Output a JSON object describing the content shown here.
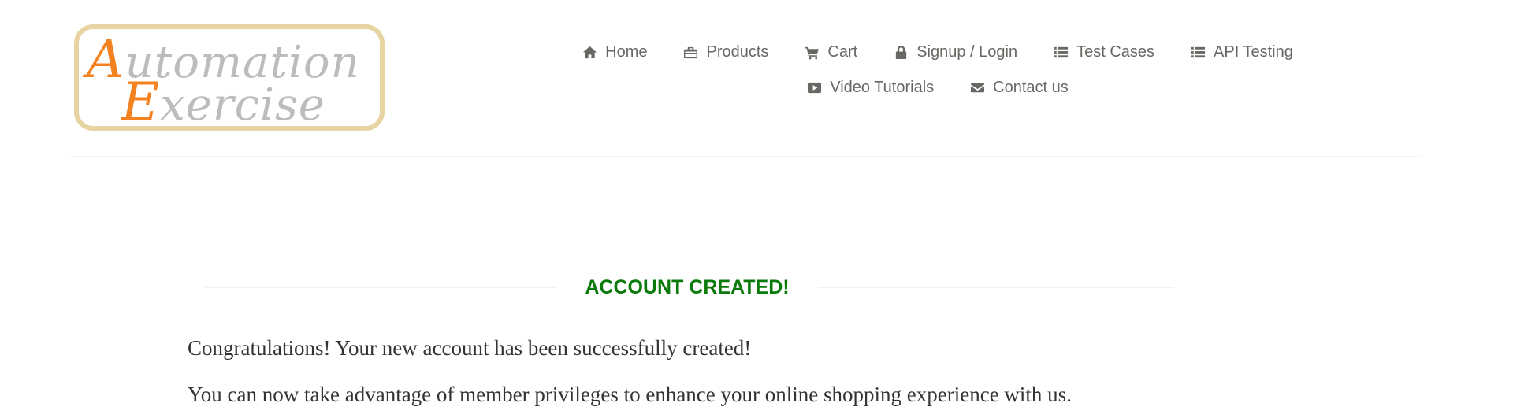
{
  "logo": {
    "line1_cap": "A",
    "line1_rest": "utomation",
    "line2_cap": "E",
    "line2_rest": "xercise",
    "colors": {
      "cap": "#f58220",
      "text": "#bcbcbc",
      "border": "#e8d3a2"
    }
  },
  "nav": {
    "items": [
      {
        "label": "Home",
        "icon": "home-icon"
      },
      {
        "label": "Products",
        "icon": "briefcase-icon"
      },
      {
        "label": "Cart",
        "icon": "cart-icon"
      },
      {
        "label": "Signup / Login",
        "icon": "lock-icon"
      },
      {
        "label": "Test Cases",
        "icon": "list-icon"
      },
      {
        "label": "API Testing",
        "icon": "list-icon"
      },
      {
        "label": "Video Tutorials",
        "icon": "youtube-play-icon"
      },
      {
        "label": "Contact us",
        "icon": "envelope-icon"
      }
    ]
  },
  "main": {
    "title": "ACCOUNT CREATED!",
    "title_color": "#0a7a0a",
    "message1": "Congratulations! Your new account has been successfully created!",
    "message2": "You can now take advantage of member privileges to enhance your online shopping experience with us."
  }
}
